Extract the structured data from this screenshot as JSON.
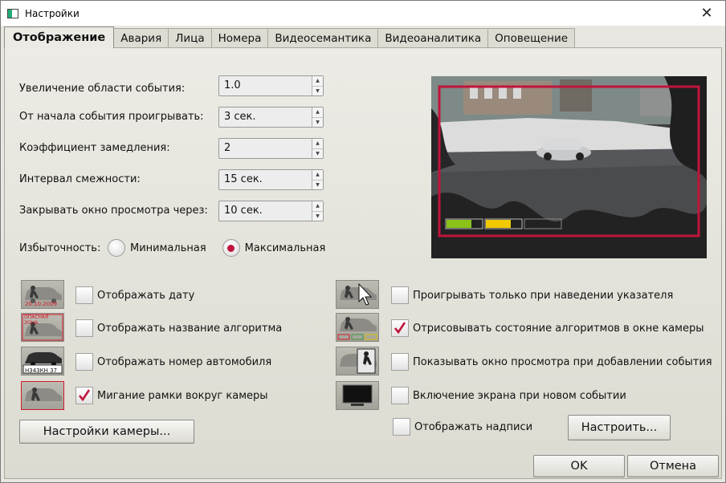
{
  "window": {
    "title": "Настройки",
    "close_glyph": "✕"
  },
  "tabs": [
    "Отображение",
    "Авария",
    "Лица",
    "Номера",
    "Видеосемантика",
    "Видеоаналитика",
    "Оповещение"
  ],
  "fields": [
    {
      "label": "Увеличение области события:",
      "value": "1.0"
    },
    {
      "label": "От начала события проигрывать:",
      "value": "3 сек."
    },
    {
      "label": "Коэффициент замедления:",
      "value": "2"
    },
    {
      "label": "Интервал смежности:",
      "value": "15 сек."
    },
    {
      "label": "Закрывать окно просмотра через:",
      "value": "10 сек."
    }
  ],
  "redundancy": {
    "label": "Избыточность:",
    "options": [
      "Минимальная",
      "Максимальная"
    ],
    "selected": "Максимальная"
  },
  "left_options": [
    {
      "label": "Отображать дату",
      "checked": false,
      "thumb_text": "20.10.2009"
    },
    {
      "label": "Отображать название алгоритма",
      "checked": false,
      "thumb_text": "ОПАСНАЯ ЗОНА"
    },
    {
      "label": "Отображать номер автомобиля",
      "checked": false,
      "thumb_text": "Н343КН 37"
    },
    {
      "label": "Мигание рамки вокруг камеры",
      "checked": true,
      "thumb_text": ""
    }
  ],
  "right_options": [
    {
      "label": "Проигрывать только при наведении указателя",
      "checked": false
    },
    {
      "label": "Отрисовывать состояние алгоритмов в окне камеры",
      "checked": true
    },
    {
      "label": "Показывать окно просмотра при добавлении события",
      "checked": false
    },
    {
      "label": "Включение экрана при новом событии",
      "checked": false
    }
  ],
  "show_captions": {
    "label": "Отображать надписи",
    "checked": false
  },
  "buttons": {
    "camera_settings": "Настройки камеры...",
    "configure": "Настроить...",
    "ok": "OK",
    "cancel": "Отмена"
  },
  "colors": {
    "accent_red": "#c0143c",
    "status_green": "#8bc21a",
    "status_yellow": "#f0c800"
  },
  "icons": {
    "app": "window-icon",
    "close": "close-icon",
    "check": "checkmark-icon",
    "pointer": "cursor-icon",
    "monitor": "monitor-icon",
    "walker": "pedestrian-icon"
  }
}
